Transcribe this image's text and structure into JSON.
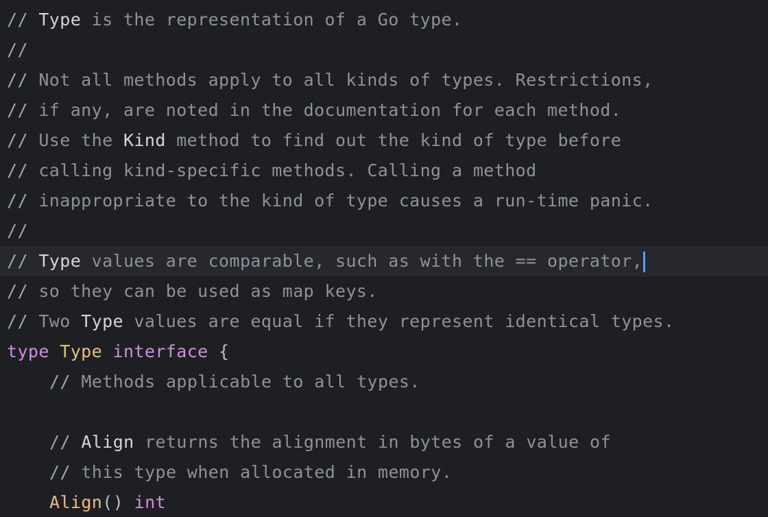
{
  "lines": [
    {
      "slash": "//",
      "segments": [
        {
          "t": " ",
          "c": "text"
        },
        {
          "t": "Type",
          "c": "ref"
        },
        {
          "t": " is the representation of a Go type.",
          "c": "text"
        }
      ]
    },
    {
      "slash": "//",
      "segments": []
    },
    {
      "slash": "//",
      "segments": [
        {
          "t": " Not all methods apply to all kinds of types. Restrictions,",
          "c": "text"
        }
      ]
    },
    {
      "slash": "//",
      "segments": [
        {
          "t": " if any, are noted in the documentation for each method.",
          "c": "text"
        }
      ]
    },
    {
      "slash": "//",
      "segments": [
        {
          "t": " Use the ",
          "c": "text"
        },
        {
          "t": "Kind",
          "c": "ref"
        },
        {
          "t": " method to find out the kind of type before",
          "c": "text"
        }
      ]
    },
    {
      "slash": "//",
      "segments": [
        {
          "t": " calling kind-specific methods. Calling a method",
          "c": "text"
        }
      ]
    },
    {
      "slash": "//",
      "segments": [
        {
          "t": " inappropriate to the kind of type causes a run-time panic.",
          "c": "text"
        }
      ]
    },
    {
      "slash": "//",
      "segments": []
    },
    {
      "slash": "//",
      "current": true,
      "segments": [
        {
          "t": " ",
          "c": "text"
        },
        {
          "t": "Type",
          "c": "ref"
        },
        {
          "t": " values are comparable, such as with the == operator,",
          "c": "text"
        }
      ]
    },
    {
      "slash": "//",
      "segments": [
        {
          "t": " so they can be used as map keys.",
          "c": "text"
        }
      ]
    },
    {
      "slash": "//",
      "segments": [
        {
          "t": " Two ",
          "c": "text"
        },
        {
          "t": "Type",
          "c": "ref"
        },
        {
          "t": " values are equal if they represent identical types.",
          "c": "text"
        }
      ]
    },
    {
      "slash": "",
      "segments": [
        {
          "t": "type",
          "c": "kw"
        },
        {
          "t": " ",
          "c": "punc"
        },
        {
          "t": "Type",
          "c": "tname"
        },
        {
          "t": " ",
          "c": "punc"
        },
        {
          "t": "interface",
          "c": "kw"
        },
        {
          "t": " {",
          "c": "punc"
        }
      ]
    },
    {
      "slash": "//",
      "indent": true,
      "segments": [
        {
          "t": " Methods applicable to all types.",
          "c": "text"
        }
      ]
    },
    {
      "slash": "",
      "segments": []
    },
    {
      "slash": "//",
      "indent": true,
      "segments": [
        {
          "t": " ",
          "c": "text"
        },
        {
          "t": "Align",
          "c": "ref"
        },
        {
          "t": " returns the alignment in bytes of a value of",
          "c": "text"
        }
      ]
    },
    {
      "slash": "//",
      "indent": true,
      "segments": [
        {
          "t": " this type when allocated in memory.",
          "c": "text"
        }
      ]
    },
    {
      "slash": "",
      "indent": true,
      "segments": [
        {
          "t": "Align",
          "c": "fn"
        },
        {
          "t": "() ",
          "c": "punc"
        },
        {
          "t": "int",
          "c": "kw"
        }
      ]
    }
  ],
  "colors": {
    "background": "#1e1f22",
    "current_line": "#26282e",
    "caret": "#4aa3ff",
    "keyword": "#cf8ee4",
    "type_name": "#e8c07a",
    "comment": "#8e929b",
    "comment_ref": "#d3d6dc"
  }
}
